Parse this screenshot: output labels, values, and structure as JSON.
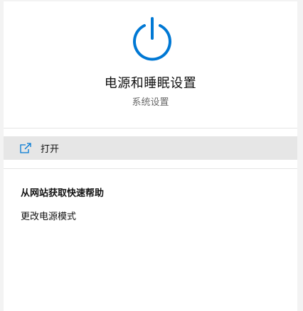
{
  "app": {
    "title": "电源和睡眠设置",
    "subtitle": "系统设置",
    "icon": "power-icon",
    "accent_color": "#0078d4"
  },
  "actions": {
    "open_label": "打开",
    "open_icon": "open-external-icon"
  },
  "help": {
    "section_title": "从网站获取快速帮助",
    "links": [
      "更改电源模式"
    ]
  }
}
